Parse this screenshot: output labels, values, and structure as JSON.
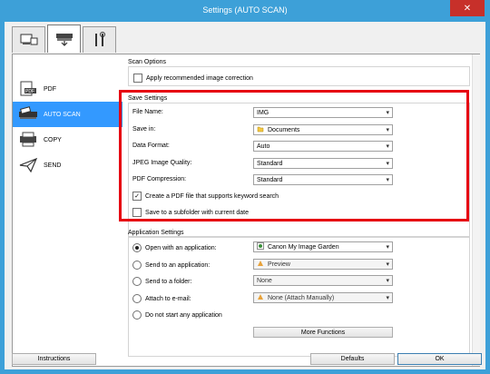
{
  "window": {
    "title": "Settings (AUTO SCAN)",
    "close_glyph": "✕"
  },
  "tabs": [
    {
      "icon": "scanner-pc-icon"
    },
    {
      "icon": "scanner-tab-icon"
    },
    {
      "icon": "tools-icon"
    }
  ],
  "nav": [
    {
      "label": "PDF",
      "icon": "pdf-icon"
    },
    {
      "label": "AUTO SCAN",
      "icon": "auto-scan-icon"
    },
    {
      "label": "COPY",
      "icon": "copy-icon"
    },
    {
      "label": "SEND",
      "icon": "send-icon"
    }
  ],
  "scan_options": {
    "title": "Scan Options",
    "apply_correction": {
      "label": "Apply recommended image correction",
      "checked": false
    }
  },
  "save_settings": {
    "title": "Save Settings",
    "file_name": {
      "label": "File Name:",
      "value": "IMG"
    },
    "save_in": {
      "label": "Save in:",
      "value": "Documents"
    },
    "data_format": {
      "label": "Data Format:",
      "value": "Auto"
    },
    "jpeg_quality": {
      "label": "JPEG Image Quality:",
      "value": "Standard"
    },
    "pdf_compression": {
      "label": "PDF Compression:",
      "value": "Standard"
    },
    "keyword_pdf": {
      "label": "Create a PDF file that supports keyword search",
      "checked": true
    },
    "subfolder": {
      "label": "Save to a subfolder with current date",
      "checked": false
    }
  },
  "app_settings": {
    "title": "Application Settings",
    "open_app": {
      "label": "Open with an application:",
      "value": "Canon My Image Garden",
      "selected": true
    },
    "send_app": {
      "label": "Send to an application:",
      "value": "Preview"
    },
    "send_folder": {
      "label": "Send to a folder:",
      "value": "None"
    },
    "attach_email": {
      "label": "Attach to e-mail:",
      "value": "None (Attach Manually)"
    },
    "no_app": {
      "label": "Do not start any application"
    },
    "more_functions": "More Functions"
  },
  "footer": {
    "instructions": "Instructions",
    "defaults": "Defaults",
    "ok": "OK"
  },
  "colors": {
    "titlebar": "#3da0d8",
    "selection": "#3399ff",
    "highlight_box": "#e60012",
    "close": "#c7302a"
  }
}
